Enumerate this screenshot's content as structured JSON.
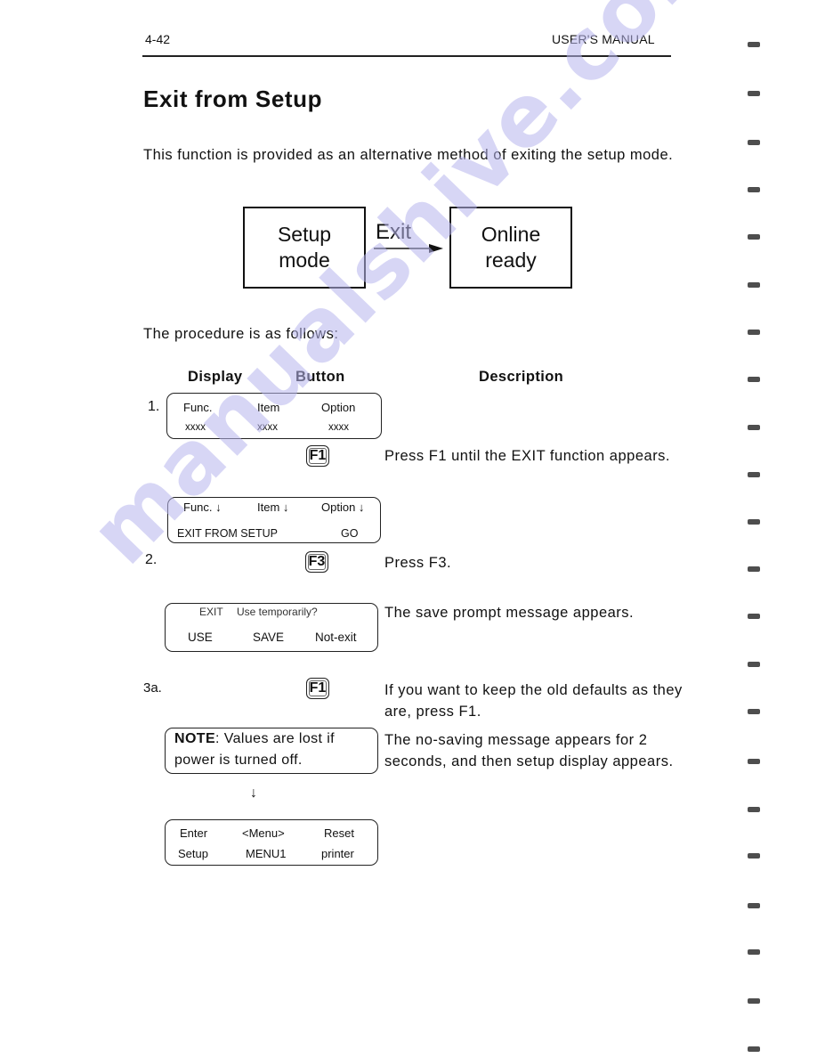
{
  "header": {
    "page_number": "4-42",
    "manual_title": "USER'S MANUAL"
  },
  "section": {
    "title": "Exit from Setup",
    "intro": "This function is provided as an alternative method of exiting the setup mode."
  },
  "flow_diagram": {
    "from_box": [
      "Setup",
      "mode"
    ],
    "transition_label": "Exit",
    "to_box": [
      "Online",
      "ready"
    ]
  },
  "procedure_intro": "The procedure is as follows:",
  "columns": {
    "display": "Display",
    "button": "Button",
    "description": "Description"
  },
  "steps": {
    "step1": {
      "number": "1.",
      "lcd": {
        "row1": [
          "Func.",
          "Item",
          "Option"
        ],
        "row2": [
          "xxxx",
          "xxxx",
          "xxxx"
        ]
      },
      "button": "F1",
      "description": "Press F1 until the EXIT function appears."
    },
    "step1_result": {
      "lcd": {
        "row1": [
          "Func. ↓",
          "Item ↓",
          "Option ↓"
        ],
        "row2": [
          "EXIT FROM SETUP",
          "GO"
        ]
      }
    },
    "step2": {
      "number": "2.",
      "button": "F3",
      "description": "Press F3."
    },
    "step2_result": {
      "lcd": {
        "row1": [
          "EXIT",
          "Use temporarily?"
        ],
        "row2": [
          "USE",
          "SAVE",
          "Not-exit"
        ]
      },
      "description": "The save prompt message appears."
    },
    "step3a": {
      "number": "3a.",
      "button": "F1",
      "description": "If you want to keep the old defaults as they are, press F1."
    },
    "step3a_note": {
      "lcd": {
        "label": "NOTE",
        "row1_rest": ": Values are lost if",
        "row2": "power is turned off."
      },
      "description": "The no-saving message appears for 2 seconds, and then setup display appears."
    },
    "step3a_final": {
      "arrow": "↓",
      "lcd": {
        "row1": [
          "Enter",
          "<Menu>",
          "Reset"
        ],
        "row2": [
          "Setup",
          "MENU1",
          "printer"
        ]
      }
    }
  },
  "watermark": "manualshive.com"
}
